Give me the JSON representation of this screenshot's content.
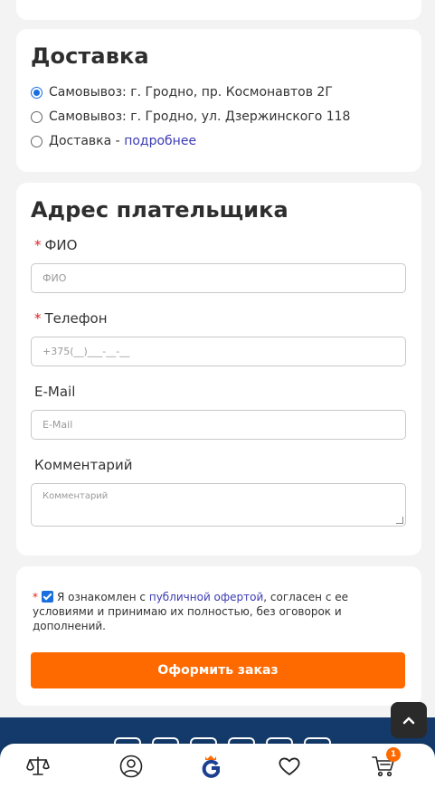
{
  "delivery": {
    "title": "Доставка",
    "options": [
      {
        "label": "Самовывоз: г. Гродно, пр. Космонавтов 2Г",
        "checked": true
      },
      {
        "label": "Самовывоз: г. Гродно, ул. Дзержинского 118",
        "checked": false
      },
      {
        "label": "Доставка - ",
        "link": "подробнее",
        "checked": false
      }
    ]
  },
  "payer": {
    "title": "Адрес плательщика",
    "fields": [
      {
        "label": "ФИО",
        "required": true,
        "placeholder": "ФИО"
      },
      {
        "label": "Телефон",
        "required": true,
        "placeholder": "+375(__)___-__-__"
      },
      {
        "label": "E-Mail",
        "required": false,
        "placeholder": "E-Mail"
      },
      {
        "label": "Комментарий",
        "required": false,
        "placeholder": "Комментарий"
      }
    ],
    "required_mark": "*"
  },
  "agreement": {
    "text_before": "Я ознакомлен с ",
    "link": "публичной офертой",
    "text_after": ", согласен с ее условиями и принимаю их полностью, без оговорок и дополнений.",
    "checked": true,
    "required_mark": "*"
  },
  "order_button": "Оформить заказ",
  "cart_count": "1",
  "icons": {
    "up": "chevron-up-icon",
    "nav": [
      "compare-scales-icon",
      "account-icon",
      "home-logo-icon",
      "favorites-heart-icon",
      "cart-icon"
    ]
  },
  "colors": {
    "accent": "#ff6a00",
    "link": "#3b3bb5",
    "footer": "#133a6b",
    "checked": "#1a6fe0"
  }
}
